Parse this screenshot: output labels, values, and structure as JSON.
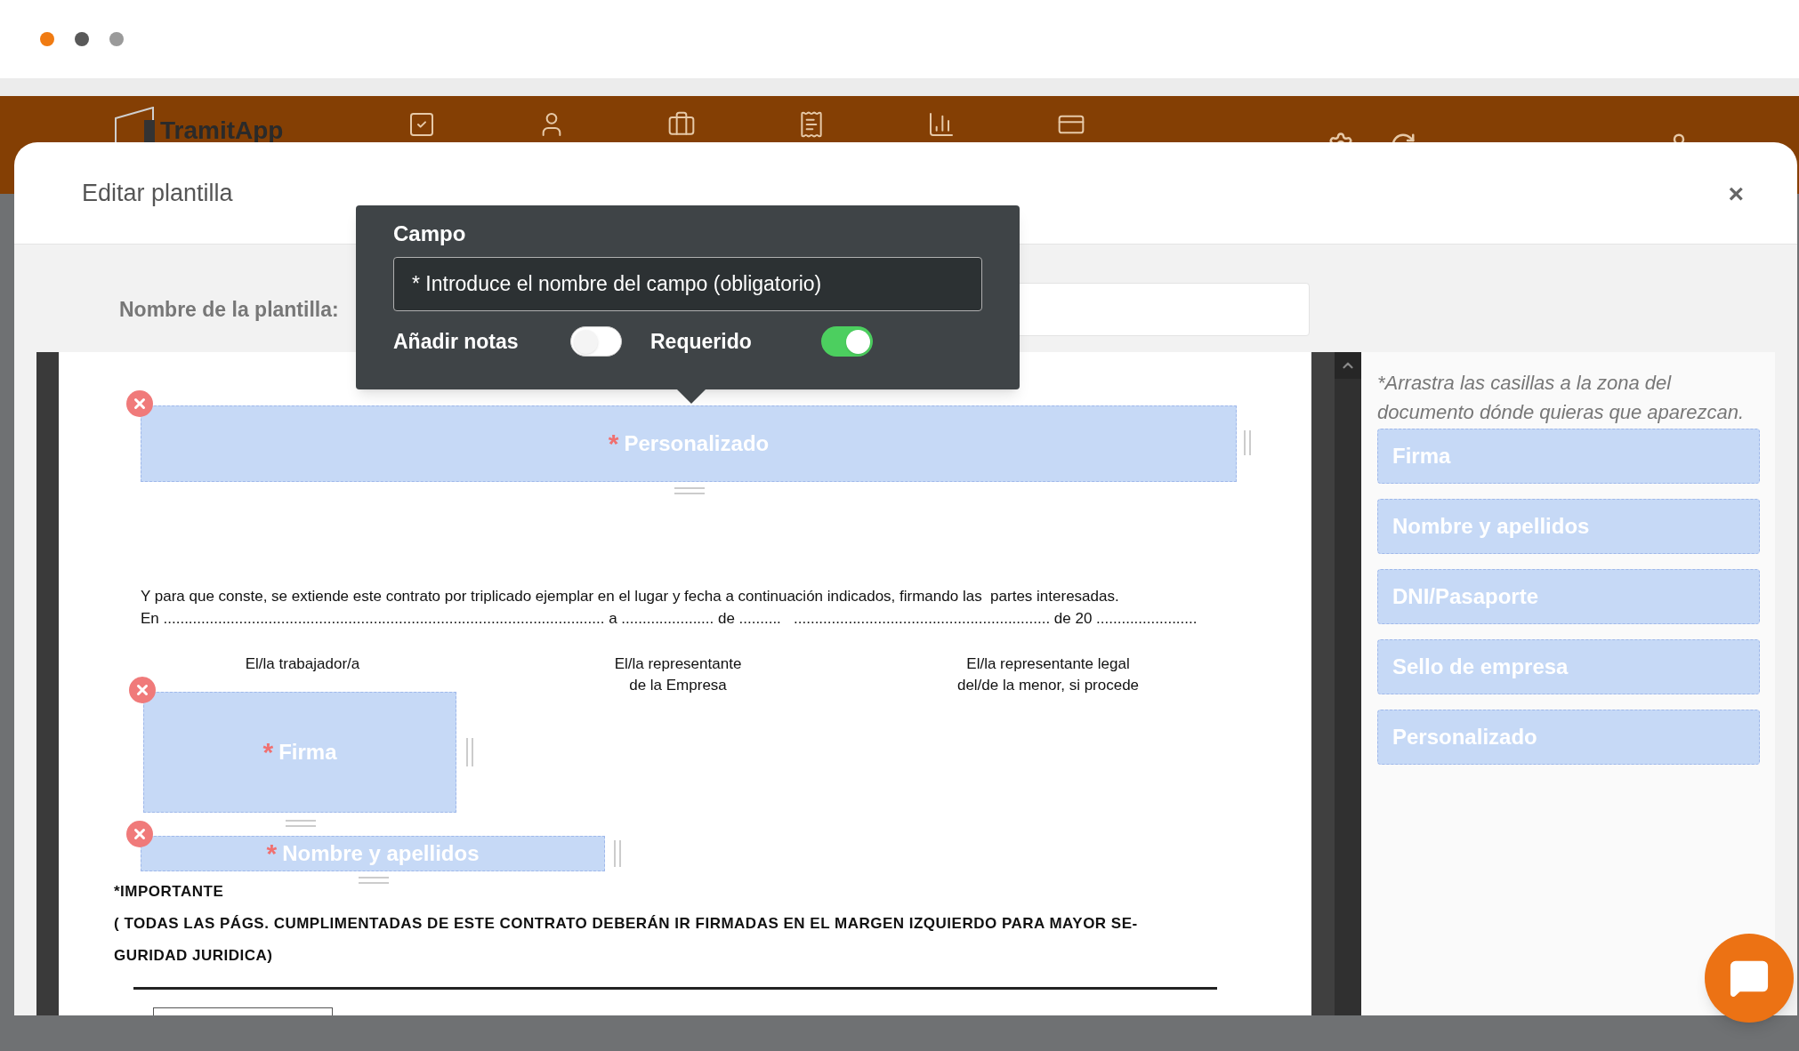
{
  "window_controls": [
    {
      "color": "#f07b12"
    },
    {
      "color": "#595959"
    },
    {
      "color": "#9a9a9a"
    }
  ],
  "app_bar": {
    "logo": "TramitApp"
  },
  "modal": {
    "title": "Editar plantilla",
    "close": "×"
  },
  "template_name": {
    "label": "Nombre de la plantilla:"
  },
  "popup": {
    "heading": "Campo",
    "field": {
      "placeholder": "* Introduce el nombre del campo (obligatorio)"
    },
    "toggles": [
      {
        "label": "Añadir notas",
        "on": false
      },
      {
        "label": "Requerido",
        "on": true
      }
    ]
  },
  "document": {
    "placed_fields": [
      {
        "label": "Personalizado",
        "mark": "*"
      },
      {
        "label": "Firma",
        "mark": "*"
      },
      {
        "label": "Nombre y apellidos",
        "mark": "*"
      }
    ],
    "paragraph": [
      "Y para que conste, se extiende este contrato por triplicado ejemplar en el lugar y fecha a continuación indicados, firmando las  partes interesadas.",
      "En ......................................................................................................... a ...................... de ..........   ............................................................. de 20 ........................"
    ],
    "signatures": [
      [
        "El/la trabajador/a"
      ],
      [
        "El/la representante",
        "de la Empresa"
      ],
      [
        "El/la representante legal",
        "del/de la menor, si procede"
      ]
    ],
    "important_title": "*IMPORTANTE",
    "important_lines": [
      "( TODAS LAS PÁGS. CUMPLIMENTADAS DE ESTE CONTRATO DEBERÁN IR FIRMADAS EN EL MARGEN IZQUIERDO PARA MAYOR SE-",
      "GURIDAD JURIDICA)"
    ]
  },
  "tools_panel": {
    "hint": "*Arrastra las casillas a la zona del documento dónde quieras que aparezcan.",
    "tools": [
      "Firma",
      "Nombre y apellidos",
      "DNI/Pasaporte",
      "Sello de empresa",
      "Personalizado"
    ]
  }
}
